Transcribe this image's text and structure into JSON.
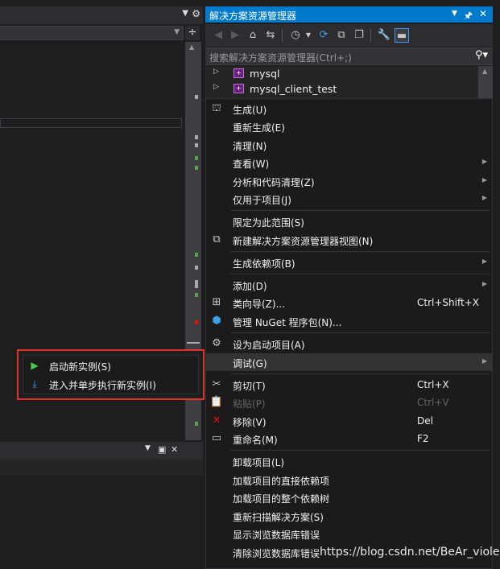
{
  "solution_explorer": {
    "title": "解决方案资源管理器",
    "search_placeholder": "搜索解决方案资源管理器(Ctrl+;)",
    "tree": [
      "mysql",
      "mysql_client_test"
    ]
  },
  "context_menu": {
    "items": [
      {
        "label": "生成(U)",
        "shortcut": "",
        "icon": "build-icon"
      },
      {
        "label": "重新生成(E)",
        "shortcut": ""
      },
      {
        "label": "清理(N)",
        "shortcut": ""
      },
      {
        "label": "查看(W)",
        "shortcut": "",
        "submenu": true
      },
      {
        "label": "分析和代码清理(Z)",
        "shortcut": "",
        "submenu": true
      },
      {
        "label": "仅用于项目(J)",
        "shortcut": "",
        "submenu": true
      },
      {
        "label": "限定为此范围(S)",
        "shortcut": ""
      },
      {
        "label": "新建解决方案资源管理器视图(N)",
        "shortcut": "",
        "icon": "new-view-icon"
      },
      {
        "label": "生成依赖项(B)",
        "shortcut": "",
        "submenu": true
      },
      {
        "label": "添加(D)",
        "shortcut": "",
        "submenu": true
      },
      {
        "label": "类向导(Z)...",
        "shortcut": "Ctrl+Shift+X",
        "icon": "class-wizard-icon"
      },
      {
        "label": "管理 NuGet 程序包(N)...",
        "shortcut": "",
        "icon": "nuget-icon"
      },
      {
        "label": "设为启动项目(A)",
        "shortcut": "",
        "icon": "gear-icon"
      },
      {
        "label": "调试(G)",
        "shortcut": "",
        "submenu": true
      },
      {
        "label": "剪切(T)",
        "shortcut": "Ctrl+X",
        "icon": "scissors-icon"
      },
      {
        "label": "粘贴(P)",
        "shortcut": "Ctrl+V",
        "icon": "paste-icon",
        "disabled": true
      },
      {
        "label": "移除(V)",
        "shortcut": "Del",
        "icon": "remove-icon"
      },
      {
        "label": "重命名(M)",
        "shortcut": "F2",
        "icon": "rename-icon"
      },
      {
        "label": "卸载项目(L)",
        "shortcut": ""
      },
      {
        "label": "加载项目的直接依赖项",
        "shortcut": ""
      },
      {
        "label": "加载项目的整个依赖树",
        "shortcut": ""
      },
      {
        "label": "重新扫描解决方案(S)",
        "shortcut": ""
      },
      {
        "label": "显示浏览数据库错误",
        "shortcut": ""
      },
      {
        "label": "清除浏览数据库错误",
        "shortcut": ""
      }
    ]
  },
  "debug_submenu": {
    "items": [
      {
        "label": "启动新实例(S)",
        "icon": "play-icon"
      },
      {
        "label": "进入并单步执行新实例(I)",
        "icon": "step-into-icon"
      }
    ]
  },
  "watermark": "https://blog.csdn.net/BeAr_violet",
  "colors": {
    "accent": "#007acc",
    "menu_bg": "#1b1b1c",
    "highlight": "#e0342b",
    "play": "#4ec94e",
    "step": "#3f9fff"
  }
}
